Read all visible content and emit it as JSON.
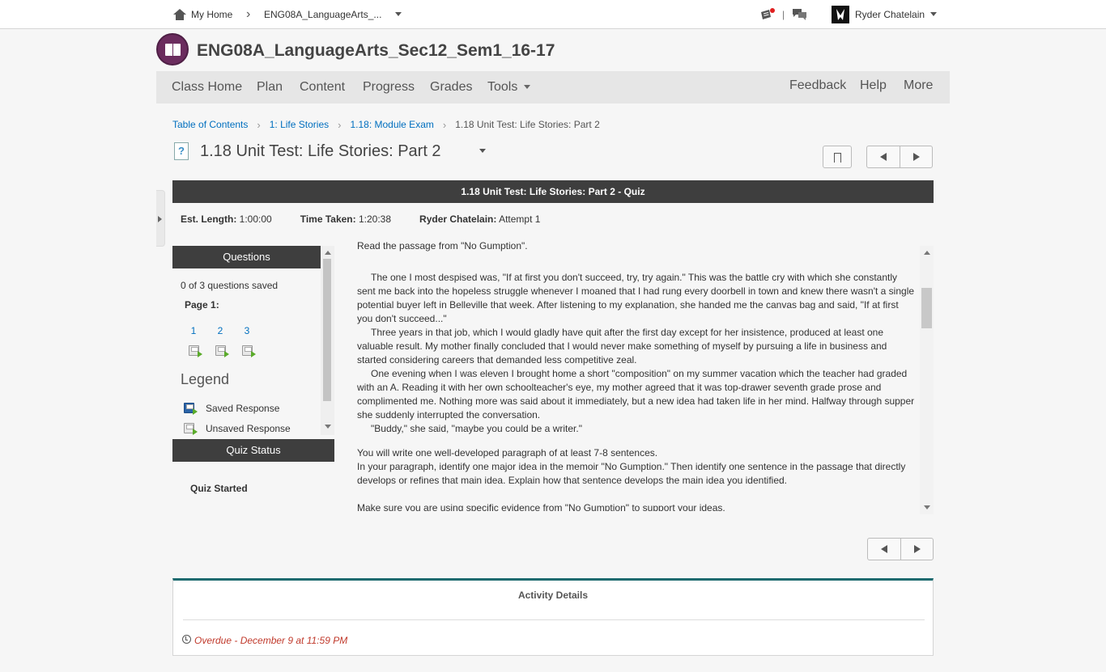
{
  "topbar": {
    "home_label": "My Home",
    "course_short": "ENG08A_LanguageArts_...",
    "user_name": "Ryder Chatelain"
  },
  "course": {
    "title": "ENG08A_LanguageArts_Sec12_Sem1_16-17"
  },
  "nav": {
    "items": [
      "Class Home",
      "Plan",
      "Content",
      "Progress",
      "Grades",
      "Tools"
    ],
    "right": [
      "Feedback",
      "Help",
      "More"
    ]
  },
  "breadcrumbs": [
    "Table of Contents",
    "1: Life Stories",
    "1.18: Module Exam",
    "1.18 Unit Test: Life Stories: Part 2"
  ],
  "page": {
    "title": "1.18 Unit Test: Life Stories: Part 2"
  },
  "quiz": {
    "header": "1.18 Unit Test: Life Stories: Part 2 - Quiz",
    "est_length_label": "Est. Length:",
    "est_length": "1:00:00",
    "time_taken_label": "Time Taken:",
    "time_taken": "1:20:38",
    "attempt_user_label": "Ryder Chatelain:",
    "attempt": "Attempt 1"
  },
  "questions_panel": {
    "title": "Questions",
    "saved": "0 of 3 questions saved",
    "page_label": "Page 1:",
    "numbers": [
      "1",
      "2",
      "3"
    ],
    "legend_title": "Legend",
    "legend_saved": "Saved Response",
    "legend_unsaved": "Unsaved Response"
  },
  "status_panel": {
    "title": "Quiz Status",
    "status": "Quiz Started"
  },
  "content": {
    "intro": "Read the passage from \"No Gumption\".",
    "paragraphs": [
      "The one I most despised was, \"If at first you don't succeed, try, try again.\" This was the battle cry with which she constantly sent me back into the hopeless struggle whenever I moaned that I had rung every doorbell in town and knew there wasn't a single potential buyer left in Belleville that week. After listening to my explanation, she handed me the canvas bag and said, \"If at first you don't succeed...\"",
      "Three years in that job, which I would gladly have quit after the first day except for her insistence, produced at least one valuable result. My mother finally concluded that I would never make something of myself by pursuing a life in business and started considering careers that demanded less competitive zeal.",
      "One evening when I was eleven I brought home a short \"composition\" on my summer vacation which the teacher had graded with an A. Reading it with her own schoolteacher's eye, my mother agreed that it was top-drawer seventh grade prose and complimented me. Nothing more was said about it immediately, but a new idea had taken life in her mind. Halfway through supper she suddenly interrupted the conversation.",
      "\"Buddy,\" she said, \"maybe you could be a writer.\""
    ],
    "instruction1": "You will write one well-developed paragraph of at least 7-8 sentences.",
    "instruction2": "In your paragraph, identify one major idea in the memoir \"No Gumption.\" Then identify one sentence in the passage that directly develops or refines that main idea. Explain how that sentence develops the main idea you identified.",
    "instruction3": "Make sure you are using specific evidence from \"No Gumption\" to support your ideas."
  },
  "activity": {
    "title": "Activity Details",
    "overdue": "Overdue - December 9 at 11:59 PM"
  },
  "colors": {
    "dark_header": "#3e3e3e",
    "link": "#006fbf",
    "overdue": "#c0392b",
    "activity_border": "#1e6a6f"
  }
}
